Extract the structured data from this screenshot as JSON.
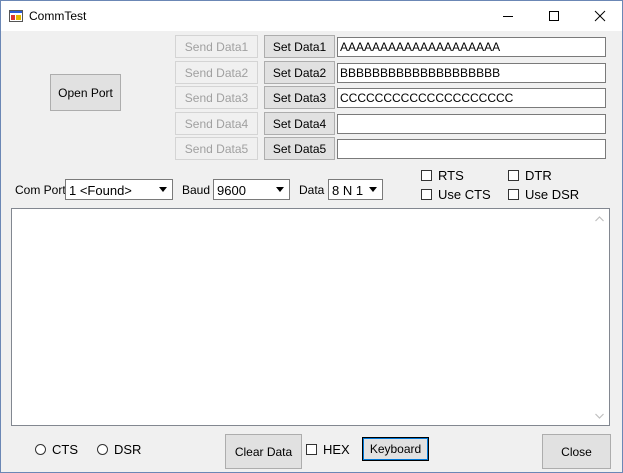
{
  "window": {
    "title": "CommTest"
  },
  "buttons": {
    "open_port": "Open Port",
    "send": [
      "Send Data1",
      "Send Data2",
      "Send Data3",
      "Send Data4",
      "Send Data5"
    ],
    "set": [
      "Set Data1",
      "Set Data2",
      "Set Data3",
      "Set Data4",
      "Set Data5"
    ],
    "clear": "Clear Data",
    "keyboard": "Keyboard",
    "close": "Close"
  },
  "data_fields": [
    "AAAAAAAAAAAAAAAAAAAA",
    "BBBBBBBBBBBBBBBBBBBB",
    "CCCCCCCCCCCCCCCCCCCC",
    "",
    ""
  ],
  "settings": {
    "com_port_label": "Com Port",
    "com_port_value": "1 <Found>",
    "baud_label": "Baud",
    "baud_value": "9600",
    "data_label": "Data",
    "data_value": "8 N 1"
  },
  "options": {
    "rts": "RTS",
    "dtr": "DTR",
    "use_cts": "Use CTS",
    "use_dsr": "Use DSR"
  },
  "status": {
    "cts": "CTS",
    "dsr": "DSR",
    "hex": "HEX"
  }
}
